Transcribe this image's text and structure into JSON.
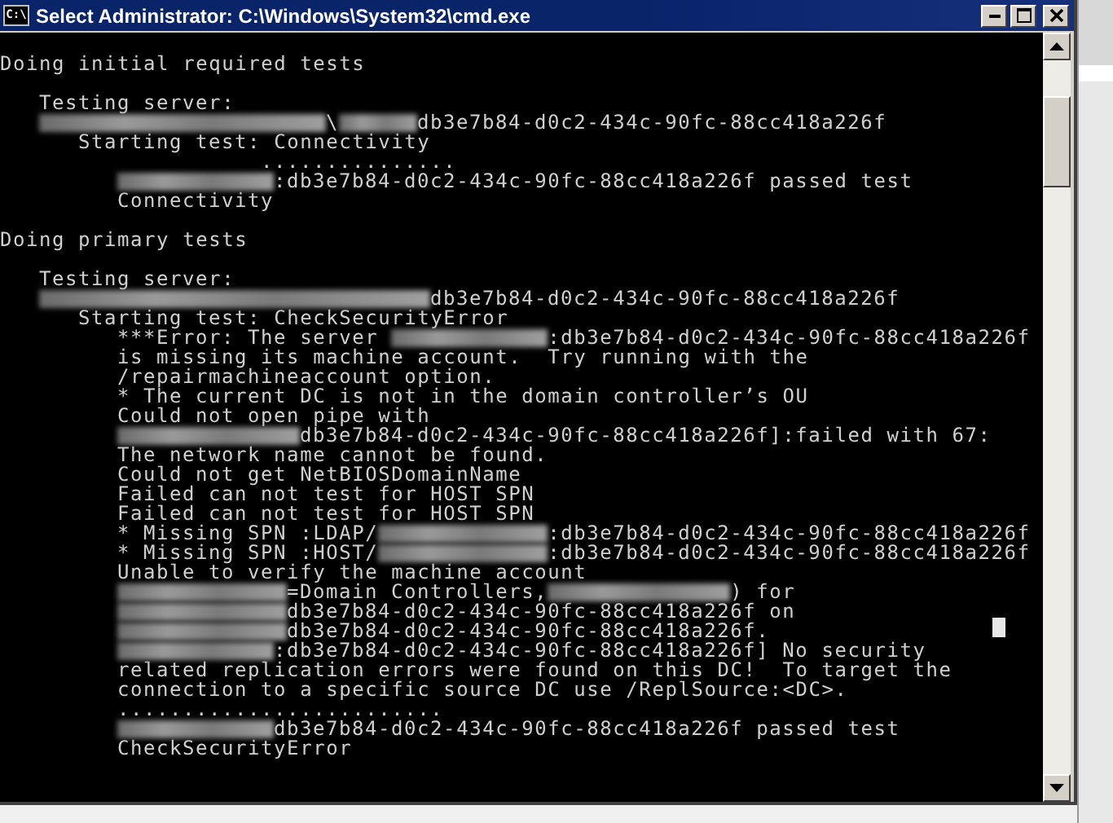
{
  "window": {
    "title": "Select Administrator: C:\\Windows\\System32\\cmd.exe",
    "icon_text": "C:\\"
  },
  "console": {
    "lines": [
      {
        "segments": [
          {
            "kind": "text",
            "text": "Doing initial required tests"
          }
        ]
      },
      {
        "segments": [
          {
            "kind": "text",
            "text": "Testing server:"
          }
        ]
      },
      {
        "segments": [
          {
            "kind": "redacted"
          },
          {
            "kind": "text",
            "text": "\\"
          },
          {
            "kind": "redacted"
          },
          {
            "kind": "text",
            "text": "db3e7b84-d0c2-434c-90fc-88cc418a226f"
          }
        ]
      },
      {
        "segments": [
          {
            "kind": "text",
            "text": "Starting test: Connectivity"
          }
        ]
      },
      {
        "segments": [
          {
            "kind": "text",
            "text": "..............."
          }
        ]
      },
      {
        "segments": [
          {
            "kind": "redacted"
          },
          {
            "kind": "text",
            "text": ":db3e7b84-d0c2-434c-90fc-88cc418a226f passed test"
          }
        ]
      },
      {
        "segments": [
          {
            "kind": "text",
            "text": "Connectivity"
          }
        ]
      },
      {
        "segments": [
          {
            "kind": "text",
            "text": "Doing primary tests"
          }
        ]
      },
      {
        "segments": [
          {
            "kind": "text",
            "text": "Testing server:"
          }
        ]
      },
      {
        "segments": [
          {
            "kind": "redacted"
          },
          {
            "kind": "text",
            "text": "db3e7b84-d0c2-434c-90fc-88cc418a226f"
          }
        ]
      },
      {
        "segments": [
          {
            "kind": "text",
            "text": "Starting test: CheckSecurityError"
          }
        ]
      },
      {
        "segments": [
          {
            "kind": "text",
            "text": "***Error: The server "
          },
          {
            "kind": "redacted"
          },
          {
            "kind": "text",
            "text": ":db3e7b84-d0c2-434c-90fc-88cc418a226f"
          }
        ]
      },
      {
        "segments": [
          {
            "kind": "text",
            "text": "is missing its machine account.  Try running with the"
          }
        ]
      },
      {
        "segments": [
          {
            "kind": "text",
            "text": "/repairmachineaccount option."
          }
        ]
      },
      {
        "segments": [
          {
            "kind": "text",
            "text": "* The current DC is not in the domain controller’s OU"
          }
        ]
      },
      {
        "segments": [
          {
            "kind": "text",
            "text": "Could not open pipe with"
          }
        ]
      },
      {
        "segments": [
          {
            "kind": "redacted"
          },
          {
            "kind": "text",
            "text": "db3e7b84-d0c2-434c-90fc-88cc418a226f]:failed with 67:"
          }
        ]
      },
      {
        "segments": [
          {
            "kind": "text",
            "text": "The network name cannot be found."
          }
        ]
      },
      {
        "segments": [
          {
            "kind": "text",
            "text": "Could not get NetBIOSDomainName"
          }
        ]
      },
      {
        "segments": [
          {
            "kind": "text",
            "text": "Failed can not test for HOST SPN"
          }
        ]
      },
      {
        "segments": [
          {
            "kind": "text",
            "text": "Failed can not test for HOST SPN"
          }
        ]
      },
      {
        "segments": [
          {
            "kind": "text",
            "text": "* Missing SPN :LDAP/"
          },
          {
            "kind": "redacted"
          },
          {
            "kind": "text",
            "text": ":db3e7b84-d0c2-434c-90fc-88cc418a226f"
          }
        ]
      },
      {
        "segments": [
          {
            "kind": "text",
            "text": "* Missing SPN :HOST/"
          },
          {
            "kind": "redacted"
          },
          {
            "kind": "text",
            "text": ":db3e7b84-d0c2-434c-90fc-88cc418a226f"
          }
        ]
      },
      {
        "segments": [
          {
            "kind": "text",
            "text": "Unable to verify the machine account"
          }
        ]
      },
      {
        "segments": [
          {
            "kind": "redacted"
          },
          {
            "kind": "text",
            "text": "=Domain Controllers,"
          },
          {
            "kind": "redacted"
          },
          {
            "kind": "text",
            "text": ") for"
          }
        ]
      },
      {
        "segments": [
          {
            "kind": "redacted"
          },
          {
            "kind": "text",
            "text": "db3e7b84-d0c2-434c-90fc-88cc418a226f on"
          }
        ]
      },
      {
        "segments": [
          {
            "kind": "redacted"
          },
          {
            "kind": "text",
            "text": "db3e7b84-d0c2-434c-90fc-88cc418a226f."
          }
        ]
      },
      {
        "segments": [
          {
            "kind": "redacted"
          },
          {
            "kind": "text",
            "text": ":db3e7b84-d0c2-434c-90fc-88cc418a226f] No security"
          }
        ]
      },
      {
        "segments": [
          {
            "kind": "text",
            "text": "related replication errors were found on this DC!  To target the"
          }
        ]
      },
      {
        "segments": [
          {
            "kind": "text",
            "text": "connection to a specific source DC use /ReplSource:<DC>."
          }
        ]
      },
      {
        "segments": [
          {
            "kind": "text",
            "text": "........................."
          }
        ]
      },
      {
        "segments": [
          {
            "kind": "redacted"
          },
          {
            "kind": "text",
            "text": "db3e7b84-d0c2-434c-90fc-88cc418a226f passed test"
          }
        ]
      },
      {
        "segments": [
          {
            "kind": "text",
            "text": "CheckSecurityError"
          }
        ]
      }
    ]
  }
}
